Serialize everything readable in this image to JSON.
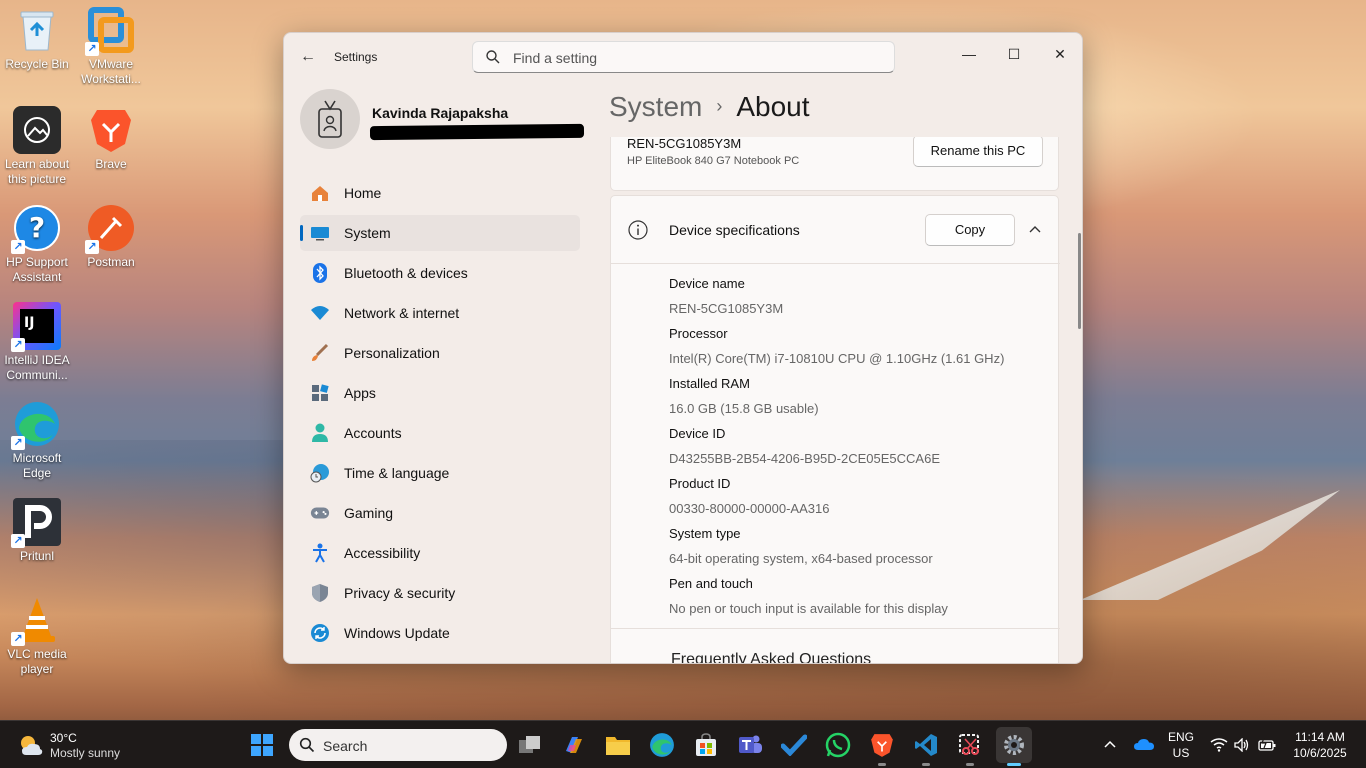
{
  "desktop": {
    "icons": [
      {
        "label": "Recycle Bin"
      },
      {
        "label": "VMware Workstati..."
      },
      {
        "label": "Learn about this picture"
      },
      {
        "label": "Brave"
      },
      {
        "label": "HP Support Assistant"
      },
      {
        "label": "Postman"
      },
      {
        "label": "IntelliJ IDEA Communi..."
      },
      {
        "label": "Microsoft Edge"
      },
      {
        "label": "Pritunl"
      },
      {
        "label": "VLC media player"
      }
    ]
  },
  "window": {
    "title": "Settings",
    "search_placeholder": "Find a setting",
    "controls": {
      "minimize": "—",
      "maximize": "☐",
      "close": "✕"
    }
  },
  "profile": {
    "name": "Kavinda Rajapaksha"
  },
  "nav": {
    "items": [
      {
        "label": "Home",
        "icon": "home-icon"
      },
      {
        "label": "System",
        "icon": "system-icon",
        "selected": true
      },
      {
        "label": "Bluetooth & devices",
        "icon": "bluetooth-icon"
      },
      {
        "label": "Network & internet",
        "icon": "wifi-icon"
      },
      {
        "label": "Personalization",
        "icon": "brush-icon"
      },
      {
        "label": "Apps",
        "icon": "apps-icon"
      },
      {
        "label": "Accounts",
        "icon": "person-icon"
      },
      {
        "label": "Time & language",
        "icon": "globe-clock-icon"
      },
      {
        "label": "Gaming",
        "icon": "gamepad-icon"
      },
      {
        "label": "Accessibility",
        "icon": "accessibility-icon"
      },
      {
        "label": "Privacy & security",
        "icon": "shield-icon"
      },
      {
        "label": "Windows Update",
        "icon": "sync-icon"
      }
    ]
  },
  "breadcrumb": {
    "parent": "System",
    "separator": "›",
    "current": "About"
  },
  "pc_card": {
    "name": "REN-5CG1085Y3M",
    "model": "HP EliteBook 840 G7 Notebook PC",
    "rename_label": "Rename this PC"
  },
  "specs": {
    "title": "Device specifications",
    "copy_label": "Copy",
    "rows": [
      {
        "label": "Device name",
        "value": "REN-5CG1085Y3M"
      },
      {
        "label": "Processor",
        "value": "Intel(R) Core(TM) i7-10810U CPU @ 1.10GHz (1.61 GHz)"
      },
      {
        "label": "Installed RAM",
        "value": "16.0 GB (15.8 GB usable)"
      },
      {
        "label": "Device ID",
        "value": "D43255BB-2B54-4206-B95D-2CE05E5CCA6E"
      },
      {
        "label": "Product ID",
        "value": "00330-80000-00000-AA316"
      },
      {
        "label": "System type",
        "value": "64-bit operating system, x64-based processor"
      },
      {
        "label": "Pen and touch",
        "value": "No pen or touch input is available for this display"
      }
    ]
  },
  "faq_heading": "Frequently Asked Questions",
  "taskbar": {
    "weather_temp": "30°C",
    "weather_desc": "Mostly sunny",
    "search_label": "Search",
    "lang_top": "ENG",
    "lang_bottom": "US",
    "time": "11:14 AM",
    "date": "10/6/2025"
  },
  "colors": {
    "accent": "#0067c0",
    "window_bg": "#f3ece8",
    "taskbar_bg": "#1e1a19"
  }
}
